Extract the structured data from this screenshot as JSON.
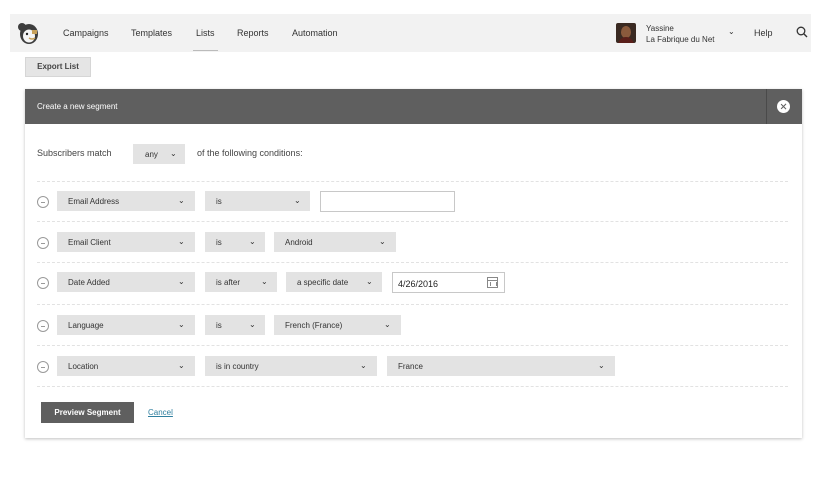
{
  "nav": {
    "items": [
      {
        "label": "Campaigns"
      },
      {
        "label": "Templates"
      },
      {
        "label": "Lists"
      },
      {
        "label": "Reports"
      },
      {
        "label": "Automation"
      }
    ],
    "active": "Lists",
    "user": {
      "name": "Yassine",
      "org": "La Fabrique du Net"
    },
    "help": "Help",
    "icons": [
      "mailchimp-logo-icon",
      "chevron-down-icon",
      "search-icon"
    ]
  },
  "toolbar": {
    "export_label": "Export List"
  },
  "segment": {
    "title": "Create a new segment",
    "match_prefix": "Subscribers match",
    "match_value": "any",
    "match_suffix": "of the following conditions:",
    "conditions": [
      {
        "field": "Email Address",
        "operator": "is",
        "value": ""
      },
      {
        "field": "Email Client",
        "operator": "is",
        "value": "Android"
      },
      {
        "field": "Date Added",
        "operator": "is after",
        "qualifier": "a specific date",
        "value": "4/26/2016"
      },
      {
        "field": "Language",
        "operator": "is",
        "value": "French (France)"
      },
      {
        "field": "Location",
        "operator": "is in country",
        "value": "France"
      }
    ],
    "preview_label": "Preview Segment",
    "cancel_label": "Cancel"
  },
  "colors": {
    "nav_bg": "#f2f2f2",
    "panel_header": "#5f5f5f",
    "select_bg": "#e3e3e3",
    "link": "#2f7f9f"
  }
}
